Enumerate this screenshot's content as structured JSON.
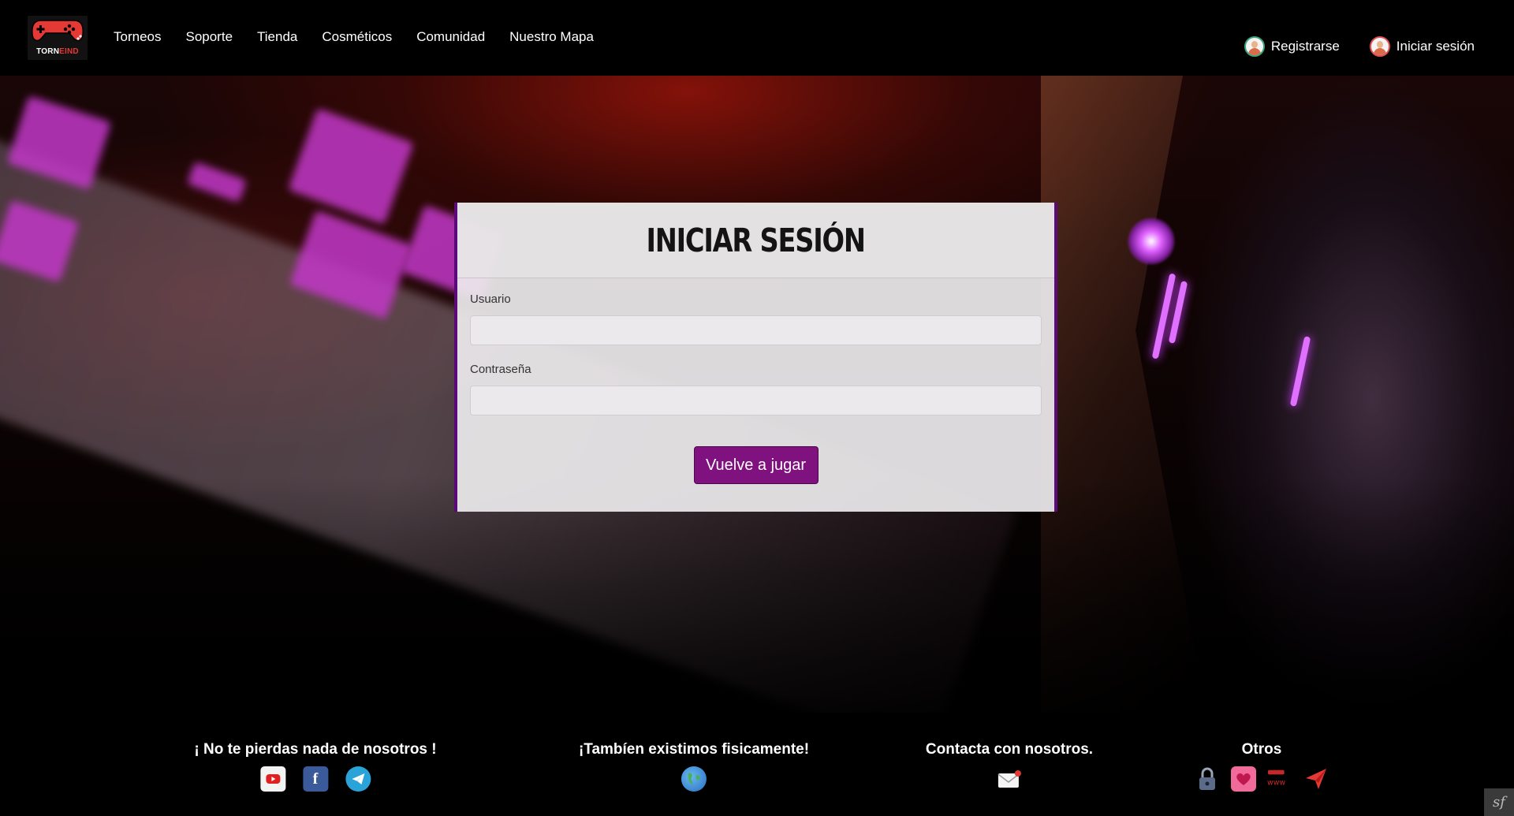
{
  "brand": {
    "logo_text_white": "TORN",
    "logo_text_red": "EIND",
    "accent": "#80127f"
  },
  "nav": {
    "links": [
      "Torneos",
      "Soporte",
      "Tienda",
      "Cosméticos",
      "Comunidad",
      "Nuestro Mapa"
    ],
    "register_label": "Registrarse",
    "login_label": "Iniciar sesión"
  },
  "login": {
    "title": "INICIAR SESIÓN",
    "username_label": "Usuario",
    "username_value": "",
    "password_label": "Contraseña",
    "password_value": "",
    "submit_label": "Vuelve a jugar"
  },
  "footer": {
    "social_title": "¡ No te pierdas nada de nosotros !",
    "social_icons": [
      "youtube-icon",
      "facebook-icon",
      "telegram-icon"
    ],
    "physical_title": "¡Tambíen existimos fisicamente!",
    "physical_icons": [
      "globe-icon"
    ],
    "contact_title": "Contacta con nosotros.",
    "contact_icons": [
      "mail-icon"
    ],
    "other_title": "Otros",
    "other_icons": [
      "lock-icon",
      "heart-icon",
      "www-icon",
      "send-icon"
    ],
    "badge": "sf"
  }
}
